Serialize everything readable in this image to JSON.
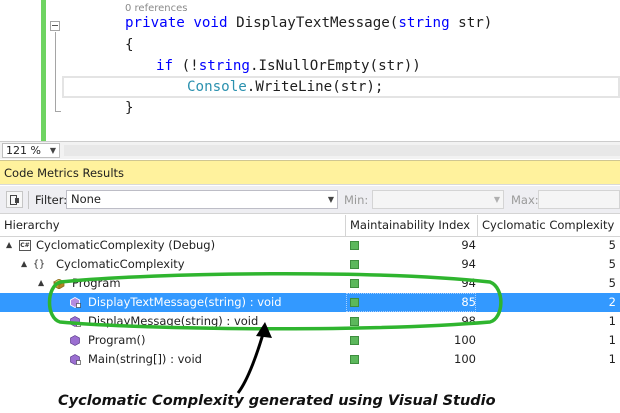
{
  "editor": {
    "references": "0 references",
    "lines": {
      "signature": {
        "kw1": "private",
        "kw2": "void",
        "name": "DisplayTextMessage(",
        "type": "string",
        "rest": " str)"
      },
      "open_brace": "{",
      "if_line": {
        "kw": "if",
        "pre": " (!",
        "type": "string",
        "rest": ".IsNullOrEmpty(str))"
      },
      "console_line": {
        "type": "Console",
        "rest": ".WriteLine(str);"
      },
      "close_brace": "}"
    },
    "zoom": "121 %"
  },
  "panel": {
    "title": "Code Metrics Results",
    "toolbar": {
      "filter_label": "Filter:",
      "filter_value": "None",
      "min_label": "Min:",
      "max_label": "Max:"
    },
    "columns": {
      "hierarchy": "Hierarchy",
      "maintainability": "Maintainability Index",
      "cyclomatic": "Cyclomatic Complexity"
    },
    "rows": [
      {
        "name": "CyclomaticComplexity (Debug)",
        "icon": "csharp-project-icon",
        "expand": "▲",
        "mi": "94",
        "cc": "5"
      },
      {
        "name": "CyclomaticComplexity",
        "icon": "namespace-icon",
        "expand": "▲",
        "mi": "94",
        "cc": "5"
      },
      {
        "name": "Program",
        "icon": "class-icon",
        "expand": "▲",
        "mi": "94",
        "cc": "5"
      },
      {
        "name": "DisplayTextMessage(string) : void",
        "icon": "private-method-icon",
        "mi": "85",
        "cc": "2",
        "selected": true
      },
      {
        "name": "DisplayMessage(string) : void",
        "icon": "private-method-icon",
        "mi": "98",
        "cc": "1"
      },
      {
        "name": "Program()",
        "icon": "method-icon",
        "mi": "100",
        "cc": "1"
      },
      {
        "name": "Main(string[]) : void",
        "icon": "private-method-icon",
        "mi": "100",
        "cc": "1"
      }
    ]
  },
  "annotation": {
    "caption": "Cyclomatic Complexity generated using Visual Studio",
    "highlight_color": "#2fb52f",
    "arrow_color": "#000000"
  },
  "colors": {
    "selection": "#3399ff",
    "panel_title_bg": "#fff29d",
    "keyword": "#0000ff",
    "type": "#2b91af",
    "mi_indicator": "#5cb85c"
  }
}
